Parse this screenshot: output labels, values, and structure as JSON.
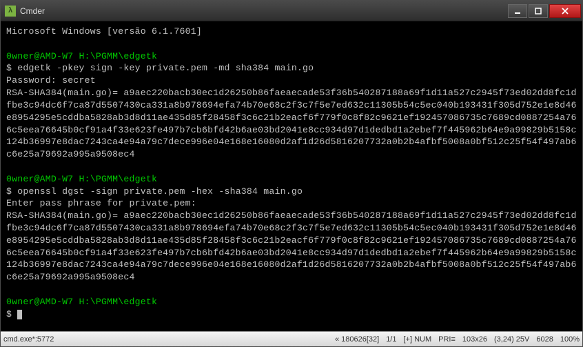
{
  "titlebar": {
    "app_icon_glyph": "λ",
    "title": "Cmder"
  },
  "terminal": {
    "header": "Microsoft Windows [versão 6.1.7601]",
    "prompt_user": "0wner@AMD-W7",
    "prompt_path": "H:\\PGMM\\edgetk",
    "prompt_symbol": "$",
    "block1": {
      "cmd": "edgetk -pkey sign -key private.pem -md sha384 main.go",
      "password_line": "Password: secret",
      "output": "RSA-SHA384(main.go)= a9aec220bacb30ec1d26250b86faeaecade53f36b540287188a69f1d11a527c2945f73ed02dd8fc1dfbe3c94dc6f7ca87d5507430ca331a8b978694efa74b70e68c2f3c7f5e7ed632c11305b54c5ec040b193431f305d752e1e8d46e8954295e5cddba5828ab3d8d11ae435d85f28458f3c6c21b2eacf6f779f0c8f82c9621ef192457086735c7689cd0887254a766c5eea76645b0cf91a4f33e623fe497b7cb6bfd42b6ae03bd2041e8cc934d97d1dedbd1a2ebef7f445962b64e9a99829b5158c124b36997e8dac7243ca4e94a79c7dece996e04e168e16080d2af1d26d5816207732a0b2b4afbf5008a0bf512c25f54f497ab6c6e25a79692a995a9508ec4"
    },
    "block2": {
      "cmd": "openssl dgst -sign private.pem -hex -sha384 main.go",
      "passphrase_line": "Enter pass phrase for private.pem:",
      "output": "RSA-SHA384(main.go)= a9aec220bacb30ec1d26250b86faeaecade53f36b540287188a69f1d11a527c2945f73ed02dd8fc1dfbe3c94dc6f7ca87d5507430ca331a8b978694efa74b70e68c2f3c7f5e7ed632c11305b54c5ec040b193431f305d752e1e8d46e8954295e5cddba5828ab3d8d11ae435d85f28458f3c6c21b2eacf6f779f0c8f82c9621ef192457086735c7689cd0887254a766c5eea76645b0cf91a4f33e623fe497b7cb6bfd42b6ae03bd2041e8cc934d97d1dedbd1a2ebef7f445962b64e9a99829b5158c124b36997e8dac7243ca4e94a79c7dece996e04e168e16080d2af1d26d5816207732a0b2b4afbf5008a0bf512c25f54f497ab6c6e25a79692a995a9508ec4"
    }
  },
  "statusbar": {
    "proc": "cmd.exe*:5772",
    "pos1": "« 180626[32]",
    "lines": "1/1",
    "encoding": "[+] NUM",
    "pri": "PRI≡",
    "size": "103x26",
    "cursor": "(3,24) 25V",
    "mem": "6028",
    "pct": "100%"
  }
}
